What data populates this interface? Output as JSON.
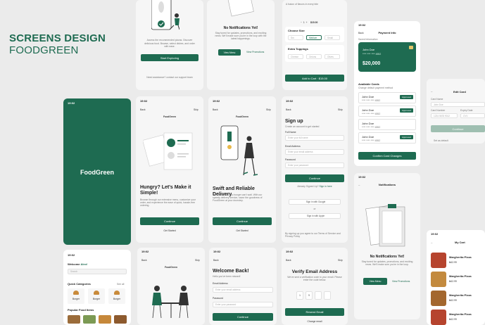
{
  "header": {
    "title": "SCREENS DESIGN",
    "subtitle": "FOODGREEN"
  },
  "time": "19:02",
  "s1": {
    "text": "Access the recommended pizzas. Discover delicious food. Browse, select dishes, and order with ease.",
    "button": "Start Exploring",
    "help": "Need assistance? contact our support team"
  },
  "s2": {
    "title": "No Notifications Yet!",
    "text": "Stay tuned for updates, promotions, and exciting news. We'll make sure you're in the loop with the latest happenings.",
    "btn1": "View Menu",
    "btn2": "View Promotions"
  },
  "s3": {
    "desc": "A fusion of flavors in every bite",
    "choose_size": "Choose Size",
    "sizes": [
      "Sm",
      "Medium",
      "Small"
    ],
    "extra": "Extra Toppings",
    "toppings": [
      "Cheese",
      "Onions",
      "Olives"
    ],
    "add": "Add to Cart · $15.00",
    "price": "$15.00"
  },
  "s4": {
    "back": "Back",
    "title": "Payment Info",
    "saved": "Saved Information",
    "card_name": "John Doe",
    "card_num": "**** **** **** 4552",
    "balance": "$20,000",
    "avail": "Available Cards",
    "avail_sub": "Change default payment method",
    "cards": [
      {
        "name": "John Doe",
        "num": "**** **** **** 4552",
        "tag": "Approved"
      },
      {
        "name": "John Doe",
        "num": "**** **** **** 4552",
        "tag": "Approved"
      },
      {
        "name": "John Doe",
        "num": "**** **** **** 4552",
        "tag": ""
      },
      {
        "name": "John Doe",
        "num": "**** **** **** 4552",
        "tag": "Approved"
      }
    ],
    "confirm": "Confirm Card Changes"
  },
  "s5": {
    "title": "Edit Card",
    "card_name": "Card Name",
    "name_val": "John Doe",
    "number": "Card Number",
    "num_val": "1234 5678 9012",
    "expiry": "Expiry Date",
    "cvv": "CVV",
    "button": "Continue",
    "default": "Set as default"
  },
  "splash": {
    "logo": "FoodGreen"
  },
  "onb1": {
    "back": "Back",
    "skip": "Skip",
    "brand": "FoodGreen",
    "title": "Hungry? Let's Make it Simple!",
    "text": "Browse through our extensive menu, customize your order, and experience the ease of quick, hassle-free ordering.",
    "button": "Continue",
    "get": "Get Started"
  },
  "onb2": {
    "back": "Back",
    "skip": "Skip",
    "brand": "FoodGreen",
    "title": "Swift and Reliable Delivery",
    "text": "We understand you hunger can't wait. With our speedy delivery service, savor the goodness of FoodGreen at your doorstep.",
    "button": "Continue",
    "get": "Get Started"
  },
  "signup": {
    "back": "Back",
    "skip": "Skip",
    "title": "Sign up",
    "sub": "Create an account to get started",
    "name": "Full Name",
    "name_ph": "Enter your full name",
    "email": "Email Address",
    "email_ph": "Enter your email address",
    "pass": "Password",
    "pass_ph": "Enter your password",
    "button": "Continue",
    "have": "Already Signed Up?",
    "signin": "Sign in here",
    "google": "Sign in with Google",
    "or": "or",
    "apple": "Sign in with Apple",
    "terms": "By signing up you agree to our Terms of Service and Privacy Policy"
  },
  "notif": {
    "title": "Notifications",
    "empty": "No Notifications Yet!",
    "text": "Stay tuned for updates, promotions, and exciting news. We'll make sure you're in the loop.",
    "btn1": "View Menu",
    "btn2": "View Promotions"
  },
  "home": {
    "welcome": "Welcome",
    "user": "Alex!",
    "search": "Search",
    "quick": "Quick Categories",
    "see": "See all",
    "cats": [
      "Burger",
      "Burger",
      "Burger"
    ],
    "popular": "Popular Food Items"
  },
  "login": {
    "back": "Back",
    "skip": "Skip",
    "brand": "FoodGreen",
    "title": "Welcome Back!",
    "sub": "Hello you've been missed!",
    "email": "Email Address",
    "email_ph": "Enter your email address",
    "pass": "Password",
    "pass_ph": "Enter your password",
    "button": "Continue"
  },
  "verify": {
    "back": "Back",
    "skip": "Skip",
    "title": "Verify Email Address",
    "text": "We've sent a verification code to your email. Please enter the code below.",
    "digits": [
      "1",
      "9",
      "",
      ""
    ],
    "button": "Resend Email",
    "alt": "Change email"
  },
  "cart": {
    "title": "My Cart",
    "items": [
      {
        "name": "Margherita Pizza",
        "price": "₦12.99"
      },
      {
        "name": "Margherita Pizza",
        "price": "₦12.99"
      },
      {
        "name": "Margherita Pizza",
        "price": "₦12.99"
      },
      {
        "name": "Margherita Pizza",
        "price": "₦12.99"
      }
    ]
  },
  "colors": {
    "primary": "#1e6b51",
    "bg": "#ebebeb"
  }
}
